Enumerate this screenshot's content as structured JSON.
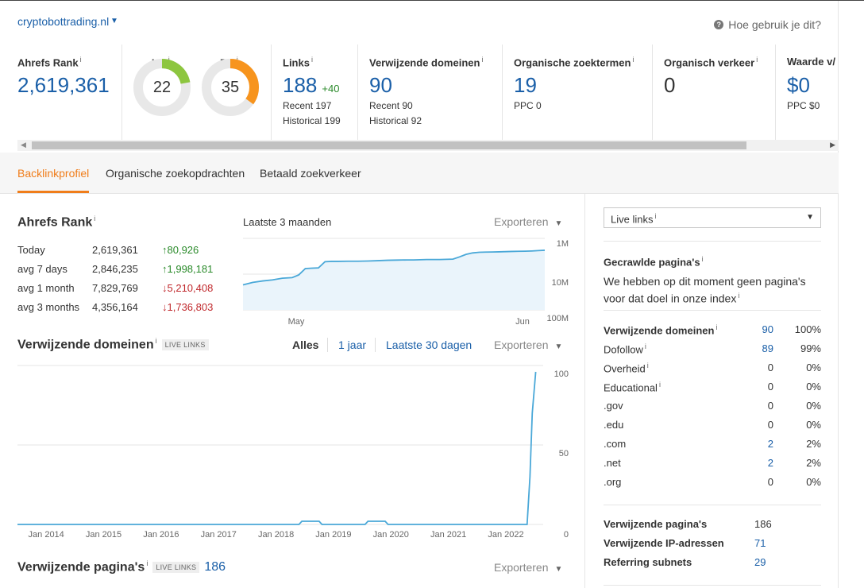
{
  "header": {
    "domain": "cryptobottrading.nl",
    "help": "Hoe gebruik je dit?"
  },
  "metrics": {
    "ahrefs_rank": {
      "label": "Ahrefs Rank",
      "value": "2,619,361"
    },
    "ur": {
      "label": "UR",
      "value": "22",
      "fraction": 0.22,
      "color": "#8dc63f"
    },
    "dr": {
      "label": "DR",
      "value": "35",
      "fraction": 0.35,
      "color": "#f7941d"
    },
    "links": {
      "label": "Links",
      "value": "188",
      "delta": "+40",
      "recent": "Recent 197",
      "historical": "Historical 199"
    },
    "ref_domains": {
      "label": "Verwijzende domeinen",
      "value": "90",
      "recent": "Recent 90",
      "historical": "Historical 92"
    },
    "organic_keywords": {
      "label": "Organische zoektermen",
      "value": "19",
      "ppc": "PPC 0"
    },
    "organic_traffic": {
      "label": "Organisch verkeer",
      "value": "0"
    },
    "traffic_value": {
      "label": "Waarde v/",
      "value": "$0",
      "ppc": "PPC $0"
    },
    "info_glyph": "i"
  },
  "tabs": [
    {
      "label": "Backlinkprofiel",
      "active": true
    },
    {
      "label": "Organische zoekopdrachten",
      "active": false
    },
    {
      "label": "Betaald zoekverkeer",
      "active": false
    }
  ],
  "rank_section": {
    "title": "Ahrefs Rank",
    "period": "Laatste 3 maanden",
    "export": "Exporteren",
    "rows": [
      {
        "label": "Today",
        "value": "2,619,361",
        "change": "80,926",
        "dir": "up"
      },
      {
        "label": "avg 7 days",
        "value": "2,846,235",
        "change": "1,998,181",
        "dir": "up"
      },
      {
        "label": "avg 1 month",
        "value": "7,829,769",
        "change": "5,210,408",
        "dir": "down"
      },
      {
        "label": "avg 3 months",
        "value": "4,356,164",
        "change": "1,736,803",
        "dir": "down"
      }
    ],
    "arrow_up": "↑",
    "arrow_down": "↓"
  },
  "ref_domains_section": {
    "title": "Verwijzende domeinen",
    "badge": "LIVE LINKS",
    "filters": [
      "Alles",
      "1 jaar",
      "Laatste 30 dagen"
    ],
    "export": "Exporteren"
  },
  "ref_pages_section": {
    "title": "Verwijzende pagina's",
    "badge": "LIVE LINKS",
    "count": "186",
    "export": "Exporteren"
  },
  "chart_data": [
    {
      "type": "area",
      "x_ticks": [
        "May",
        "Jun"
      ],
      "y_ticks": [
        "1M",
        "10M",
        "100M"
      ],
      "y_scale": "log",
      "y_reversed": true,
      "color": "#4aa8d8",
      "x": [
        0,
        3,
        6,
        9,
        12,
        15,
        17,
        19,
        21,
        23,
        25,
        27,
        29,
        32,
        35,
        38,
        41,
        44,
        47,
        50,
        52,
        54,
        56,
        58,
        60,
        62,
        64,
        66,
        68,
        70,
        72,
        74,
        76,
        78,
        80,
        82,
        84,
        86,
        88,
        90,
        92
      ],
      "values": [
        20000000,
        17000000,
        15500000,
        14500000,
        13000000,
        12500000,
        10500000,
        7000000,
        6800000,
        6700000,
        4500000,
        4400000,
        4400000,
        4350000,
        4350000,
        4300000,
        4200000,
        4100000,
        4050000,
        4000000,
        4000000,
        3950000,
        3900000,
        3900000,
        3900000,
        3850000,
        3800000,
        3300000,
        2800000,
        2550000,
        2450000,
        2420000,
        2400000,
        2380000,
        2350000,
        2320000,
        2300000,
        2280000,
        2250000,
        2200000,
        2150000
      ]
    },
    {
      "type": "line",
      "x_ticks": [
        "Jan 2014",
        "Jan 2015",
        "Jan 2016",
        "Jan 2017",
        "Jan 2018",
        "Jan 2019",
        "Jan 2020",
        "Jan 2021",
        "Jan 2022"
      ],
      "y_ticks": [
        "0",
        "50",
        "100"
      ],
      "ylim": [
        0,
        100
      ],
      "color": "#4aa8d8",
      "x": [
        2013.5,
        2018.4,
        2018.45,
        2018.75,
        2018.8,
        2019.55,
        2019.6,
        2019.9,
        2019.95,
        2022.37,
        2022.42,
        2022.46,
        2022.52
      ],
      "values": [
        0,
        0,
        2,
        2,
        0,
        0,
        2,
        2,
        0,
        0,
        30,
        70,
        96
      ]
    }
  ],
  "right_panel": {
    "select": "Live links",
    "crawled_title": "Gecrawlde pagina's",
    "crawled_text": "We hebben op dit moment geen pagina's voor dat doel in onze index",
    "rows": [
      {
        "label": "Verwijzende domeinen",
        "bold": true,
        "info": true,
        "value": "90",
        "link": true,
        "pct": "100%"
      },
      {
        "label": "Dofollow",
        "bold": false,
        "info": true,
        "value": "89",
        "link": true,
        "pct": "99%"
      },
      {
        "label": "Overheid",
        "bold": false,
        "info": true,
        "value": "0",
        "link": false,
        "pct": "0%"
      },
      {
        "label": "Educational",
        "bold": false,
        "info": true,
        "value": "0",
        "link": false,
        "pct": "0%"
      },
      {
        "label": ".gov",
        "bold": false,
        "info": false,
        "value": "0",
        "link": false,
        "pct": "0%"
      },
      {
        "label": ".edu",
        "bold": false,
        "info": false,
        "value": "0",
        "link": false,
        "pct": "0%"
      },
      {
        "label": ".com",
        "bold": false,
        "info": false,
        "value": "2",
        "link": true,
        "pct": "2%"
      },
      {
        "label": ".net",
        "bold": false,
        "info": false,
        "value": "2",
        "link": true,
        "pct": "2%"
      },
      {
        "label": ".org",
        "bold": false,
        "info": false,
        "value": "0",
        "link": false,
        "pct": "0%"
      }
    ],
    "totals": [
      {
        "label": "Verwijzende pagina's",
        "value": "186",
        "link": false
      },
      {
        "label": "Verwijzende IP-adressen",
        "value": "71",
        "link": true
      },
      {
        "label": "Referring subnets",
        "value": "29",
        "link": true
      }
    ]
  }
}
